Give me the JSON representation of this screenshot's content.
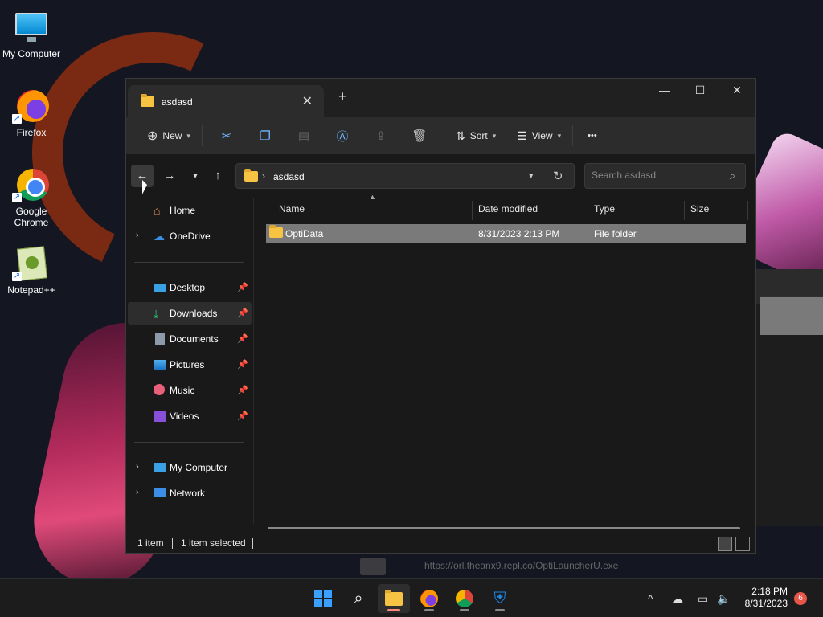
{
  "desktop": {
    "icons": [
      {
        "label": "My Computer",
        "icon": "monitor-icon"
      },
      {
        "label": "Firefox",
        "icon": "firefox-icon"
      },
      {
        "label": "Google Chrome",
        "icon": "chrome-icon"
      },
      {
        "label": "Notepad++",
        "icon": "notepadpp-icon"
      }
    ]
  },
  "window": {
    "tab_title": "asdasd",
    "new_tab_glyph": "+",
    "controls": {
      "minimize": "—",
      "maximize": "☐",
      "close": "✕"
    },
    "toolbar": {
      "new_label": "New",
      "sort_label": "Sort",
      "view_label": "View",
      "more_label": "•••"
    },
    "address": {
      "path": "asdasd",
      "search_placeholder": "Search asdasd"
    },
    "sidebar": {
      "items": [
        {
          "label": "Home",
          "icon": "home-icon"
        },
        {
          "label": "OneDrive",
          "icon": "cloud-icon"
        },
        {
          "label": "Desktop",
          "icon": "desktop-icon"
        },
        {
          "label": "Downloads",
          "icon": "download-icon"
        },
        {
          "label": "Documents",
          "icon": "document-icon"
        },
        {
          "label": "Pictures",
          "icon": "picture-icon"
        },
        {
          "label": "Music",
          "icon": "music-icon"
        },
        {
          "label": "Videos",
          "icon": "video-icon"
        },
        {
          "label": "My Computer",
          "icon": "computer-icon"
        },
        {
          "label": "Network",
          "icon": "network-icon"
        }
      ]
    },
    "columns": [
      "Name",
      "Date modified",
      "Type",
      "Size"
    ],
    "rows": [
      {
        "name": "OptiData",
        "date": "8/31/2023 2:13 PM",
        "type": "File folder",
        "size": ""
      }
    ],
    "status": {
      "count": "1 item",
      "selected": "1 item selected"
    }
  },
  "background_url": "https://orl.theanx9.repl.co/OptiLauncherU.exe",
  "taskbar": {
    "time": "2:18 PM",
    "date": "8/31/2023",
    "notification_count": "6"
  },
  "colors": {
    "accent": "#3aa0ff",
    "folder": "#f6c342",
    "selected_row": "#7a7a7a"
  }
}
